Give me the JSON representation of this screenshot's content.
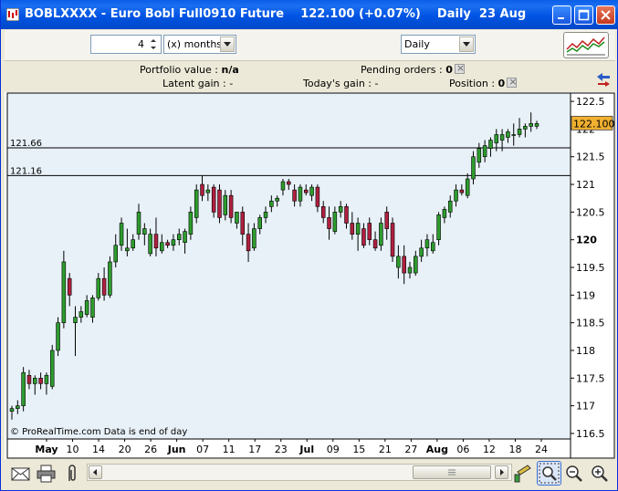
{
  "window": {
    "instrument": "BOBLXXXX",
    "title": "BOBLXXXX - Euro Bobl Full0910 Future    122.100 (+0.07%)    Daily  23 Aug",
    "buttons": [
      "minimize",
      "maximize",
      "close"
    ]
  },
  "toolbar": {
    "period_count": "4",
    "period_unit": "(x) months",
    "interval": "Daily"
  },
  "info": {
    "portfolio_label": "Portfolio value :",
    "portfolio_value": "n/a",
    "pending_label": "Pending orders :",
    "pending_value": "0",
    "latent_label": "Latent gain :",
    "latent_value": "-",
    "today_label": "Today's gain :",
    "today_value": "-",
    "position_label": "Position :",
    "position_value": "0"
  },
  "chart_data": {
    "type": "candlestick",
    "y_ticks": [
      "122.5",
      "122",
      "121.5",
      "121",
      "120.5",
      "120",
      "119.5",
      "119",
      "118.5",
      "118",
      "117.5",
      "117",
      "116.5"
    ],
    "ylim": [
      116.4,
      122.65
    ],
    "x_tick_labels": [
      "May",
      "10",
      "14",
      "20",
      "26",
      "Jun",
      "07",
      "11",
      "17",
      "23",
      "Jul",
      "09",
      "15",
      "21",
      "27",
      "Aug",
      "06",
      "12",
      "18",
      "24"
    ],
    "x_bold_labels": [
      "May",
      "Jun",
      "Jul",
      "Aug"
    ],
    "bold_y_tick": "120",
    "horizontal_lines": [
      {
        "label": "121.66",
        "value": 121.66
      },
      {
        "label": "121.16",
        "value": 121.16
      }
    ],
    "last_price": "122.100",
    "last_value": 122.1,
    "footer": "© ProRealTime.com  Data is end of day",
    "colors": {
      "up": "#2e9c2e",
      "down": "#b0203f",
      "background": "#e8f1f8",
      "last_price_bg": "#f0b030"
    },
    "candles": [
      [
        116.9,
        117.0,
        116.75,
        116.95
      ],
      [
        116.95,
        117.1,
        116.85,
        117.0
      ],
      [
        117.0,
        117.7,
        116.9,
        117.6
      ],
      [
        117.55,
        117.65,
        117.3,
        117.4
      ],
      [
        117.4,
        117.55,
        117.2,
        117.5
      ],
      [
        117.5,
        117.6,
        117.3,
        117.4
      ],
      [
        117.4,
        117.6,
        117.2,
        117.55
      ],
      [
        117.35,
        118.1,
        117.3,
        118.0
      ],
      [
        118.0,
        118.6,
        117.9,
        118.5
      ],
      [
        118.5,
        119.8,
        118.4,
        119.6
      ],
      [
        119.3,
        119.4,
        118.8,
        119.0
      ],
      [
        118.5,
        118.8,
        117.9,
        118.6
      ],
      [
        118.6,
        118.8,
        118.5,
        118.7
      ],
      [
        118.65,
        119.0,
        118.6,
        118.9
      ],
      [
        118.6,
        119.0,
        118.5,
        118.95
      ],
      [
        118.95,
        119.4,
        118.9,
        119.3
      ],
      [
        119.3,
        119.5,
        118.9,
        119.0
      ],
      [
        119.0,
        119.7,
        118.95,
        119.6
      ],
      [
        119.6,
        120.1,
        119.5,
        119.9
      ],
      [
        119.9,
        120.4,
        119.8,
        120.3
      ],
      [
        119.8,
        120.2,
        119.7,
        119.85
      ],
      [
        119.85,
        120.1,
        119.8,
        120.0
      ],
      [
        120.1,
        120.65,
        120.0,
        120.5
      ],
      [
        120.1,
        120.3,
        119.9,
        120.2
      ],
      [
        119.75,
        120.2,
        119.7,
        120.1
      ],
      [
        120.1,
        120.4,
        119.7,
        119.85
      ],
      [
        119.8,
        120.1,
        119.75,
        119.95
      ],
      [
        119.95,
        120.0,
        119.85,
        119.9
      ],
      [
        119.9,
        120.1,
        119.8,
        120.0
      ],
      [
        120.0,
        120.2,
        119.9,
        120.1
      ],
      [
        119.95,
        120.2,
        119.75,
        120.15
      ],
      [
        120.1,
        120.6,
        120.0,
        120.5
      ],
      [
        120.4,
        121.0,
        120.3,
        120.9
      ],
      [
        121.0,
        121.15,
        120.7,
        120.8
      ],
      [
        120.85,
        121.0,
        120.7,
        120.9
      ],
      [
        120.95,
        121.0,
        120.4,
        120.5
      ],
      [
        120.9,
        121.0,
        120.3,
        120.4
      ],
      [
        120.45,
        120.9,
        120.35,
        120.8
      ],
      [
        120.8,
        120.9,
        120.3,
        120.4
      ],
      [
        120.3,
        120.5,
        120.2,
        120.5
      ],
      [
        120.5,
        120.6,
        119.9,
        120.1
      ],
      [
        120.1,
        120.3,
        119.6,
        119.8
      ],
      [
        119.85,
        120.3,
        119.8,
        120.2
      ],
      [
        120.2,
        120.45,
        120.1,
        120.4
      ],
      [
        120.4,
        120.6,
        120.3,
        120.5
      ],
      [
        120.6,
        120.8,
        120.5,
        120.7
      ],
      [
        120.7,
        120.8,
        120.6,
        120.75
      ],
      [
        120.9,
        121.1,
        120.8,
        121.05
      ],
      [
        121.05,
        121.1,
        120.9,
        121.0
      ],
      [
        120.9,
        121.0,
        120.6,
        120.7
      ],
      [
        120.7,
        121.0,
        120.6,
        120.95
      ],
      [
        120.9,
        121.0,
        120.8,
        120.85
      ],
      [
        120.8,
        121.0,
        120.7,
        120.95
      ],
      [
        120.95,
        121.0,
        120.5,
        120.6
      ],
      [
        120.6,
        120.7,
        120.3,
        120.4
      ],
      [
        120.4,
        120.6,
        120.0,
        120.2
      ],
      [
        120.15,
        120.6,
        120.1,
        120.5
      ],
      [
        120.5,
        120.7,
        120.4,
        120.6
      ],
      [
        120.6,
        120.65,
        120.2,
        120.3
      ],
      [
        120.3,
        120.5,
        120.0,
        120.1
      ],
      [
        120.1,
        120.4,
        119.8,
        120.3
      ],
      [
        120.2,
        120.3,
        119.85,
        119.9
      ],
      [
        120.3,
        120.4,
        119.9,
        120.0
      ],
      [
        120.0,
        120.15,
        119.8,
        119.85
      ],
      [
        119.9,
        120.4,
        119.8,
        120.3
      ],
      [
        120.5,
        120.6,
        120.0,
        120.2
      ],
      [
        120.3,
        120.4,
        119.6,
        119.7
      ],
      [
        119.5,
        119.9,
        119.3,
        119.7
      ],
      [
        119.7,
        119.9,
        119.2,
        119.4
      ],
      [
        119.4,
        119.6,
        119.3,
        119.5
      ],
      [
        119.4,
        119.8,
        119.35,
        119.7
      ],
      [
        119.7,
        120.0,
        119.6,
        119.85
      ],
      [
        119.85,
        120.1,
        119.7,
        120.0
      ],
      [
        119.8,
        120.1,
        119.75,
        119.95
      ],
      [
        120.0,
        120.5,
        119.9,
        120.45
      ],
      [
        120.4,
        120.6,
        120.3,
        120.55
      ],
      [
        120.5,
        120.8,
        120.4,
        120.7
      ],
      [
        120.7,
        121.0,
        120.6,
        120.9
      ],
      [
        120.9,
        121.0,
        120.8,
        120.85
      ],
      [
        120.8,
        121.2,
        120.75,
        121.1
      ],
      [
        121.1,
        121.6,
        121.0,
        121.5
      ],
      [
        121.4,
        121.75,
        121.3,
        121.65
      ],
      [
        121.5,
        121.8,
        121.4,
        121.7
      ],
      [
        121.65,
        121.85,
        121.5,
        121.8
      ],
      [
        121.75,
        122.0,
        121.6,
        121.9
      ],
      [
        121.8,
        122.0,
        121.6,
        121.9
      ],
      [
        121.85,
        122.0,
        121.75,
        121.95
      ],
      [
        121.9,
        122.1,
        121.7,
        121.9
      ],
      [
        121.9,
        122.2,
        121.85,
        122.0
      ],
      [
        122.0,
        122.1,
        121.85,
        122.05
      ],
      [
        122.05,
        122.3,
        121.95,
        122.1
      ],
      [
        122.05,
        122.15,
        122.0,
        122.1
      ]
    ]
  }
}
